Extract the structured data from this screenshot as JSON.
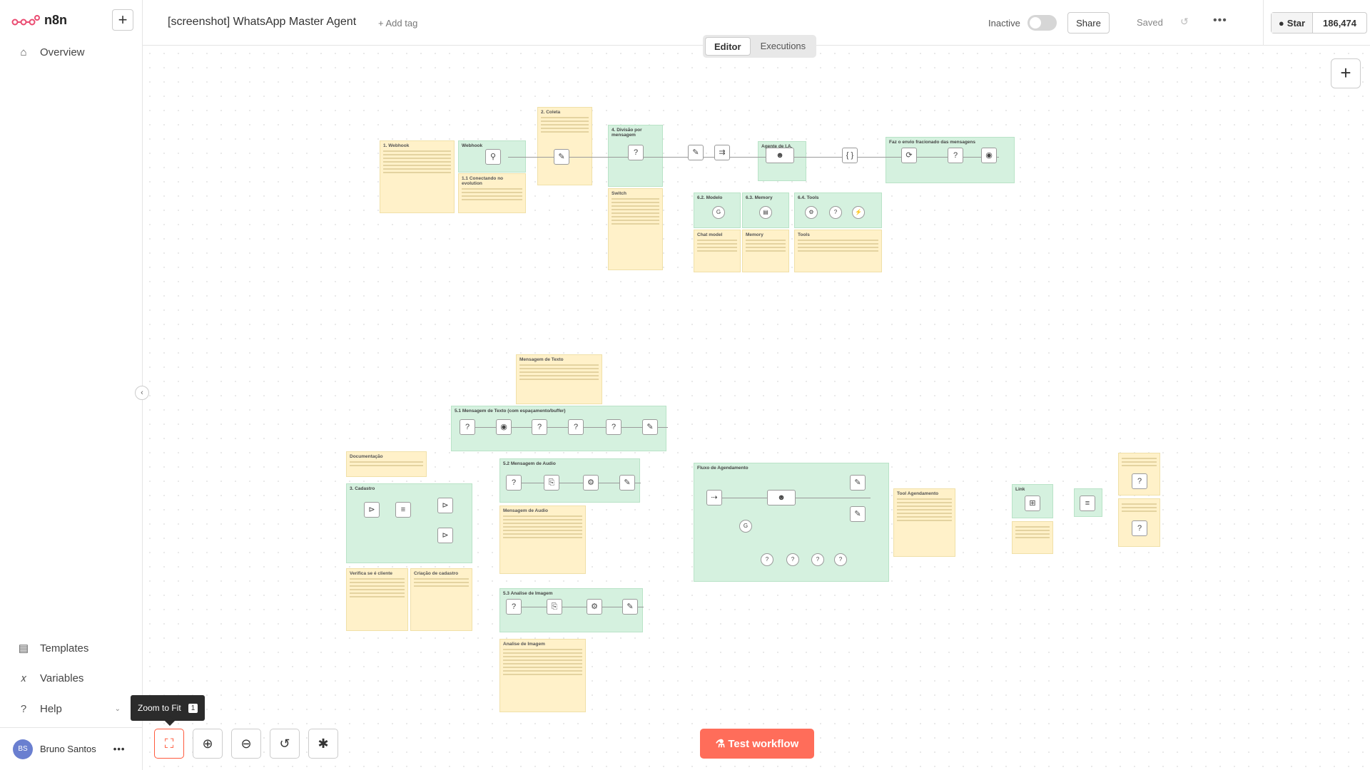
{
  "app": {
    "logo_text": "n8n",
    "new_label": "+"
  },
  "sidebar": {
    "items": [
      {
        "icon": "home-icon",
        "label": "Overview"
      },
      {
        "icon": "templates-icon",
        "label": "Templates"
      },
      {
        "icon": "variables-icon",
        "label": "Variables"
      },
      {
        "icon": "help-icon",
        "label": "Help"
      }
    ]
  },
  "user": {
    "initials": "BS",
    "name": "Bruno Santos",
    "menu": "•••"
  },
  "topbar": {
    "workflow_name": "[screenshot] WhatsApp Master Agent",
    "add_tag": "+ Add tag",
    "status_label": "Inactive",
    "active": false,
    "share_label": "Share",
    "saved_label": "Saved",
    "undo_icon": "undo-icon",
    "more_label": "•••"
  },
  "github": {
    "star_label": "Star",
    "star_count": "186,474"
  },
  "tabs": [
    {
      "label": "Editor",
      "active": true
    },
    {
      "label": "Executions",
      "active": false
    }
  ],
  "canvas": {
    "stickies": [
      {
        "id": "webhook",
        "title": "1. Webhook"
      },
      {
        "id": "coleta",
        "title": "2. Coleta"
      },
      {
        "id": "connect",
        "title": "1.1 Conectando no evolution"
      },
      {
        "id": "switch",
        "title": "Switch"
      },
      {
        "id": "chatmodel",
        "title": "Chat model"
      },
      {
        "id": "memory",
        "title": "Memory"
      },
      {
        "id": "tools",
        "title": "Tools"
      },
      {
        "id": "msgtexto",
        "title": "Mensagem de Texto"
      },
      {
        "id": "doc",
        "title": "Documentação"
      },
      {
        "id": "msgaudio",
        "title": "Mensagem de Audio"
      },
      {
        "id": "verifica",
        "title": "Verifica se é cliente"
      },
      {
        "id": "criacao",
        "title": "Criação de cadastro"
      },
      {
        "id": "tool-agend",
        "title": "Tool Agendamento"
      },
      {
        "id": "analise",
        "title": "Analise de Imagem"
      }
    ],
    "groups": [
      {
        "id": "webhook-g",
        "title": "Webhook"
      },
      {
        "id": "divisao",
        "title": "4. Divisão por mensagem"
      },
      {
        "id": "agente",
        "title": "Agente de I.A."
      },
      {
        "id": "envio",
        "title": "Faz o envio fracionado das mensagens"
      },
      {
        "id": "modelo",
        "title": "6.2. Modelo"
      },
      {
        "id": "memoria",
        "title": "6.3. Memory"
      },
      {
        "id": "tools-g",
        "title": "6.4. Tools"
      },
      {
        "id": "texto",
        "title": "5.1 Mensagem de Texto (com espaçamento/buffer)"
      },
      {
        "id": "audio",
        "title": "5.2 Mensagem de Audio"
      },
      {
        "id": "cadastro",
        "title": "3. Cadastro"
      },
      {
        "id": "agendamento",
        "title": "Fluxo de Agendamento"
      },
      {
        "id": "imagem",
        "title": "5.3 Analise de Imagem"
      },
      {
        "id": "link",
        "title": "Link"
      }
    ]
  },
  "controls": {
    "zoom_tip": "Zoom to Fit",
    "zoom_key": "1",
    "test_label": "Test workflow"
  }
}
